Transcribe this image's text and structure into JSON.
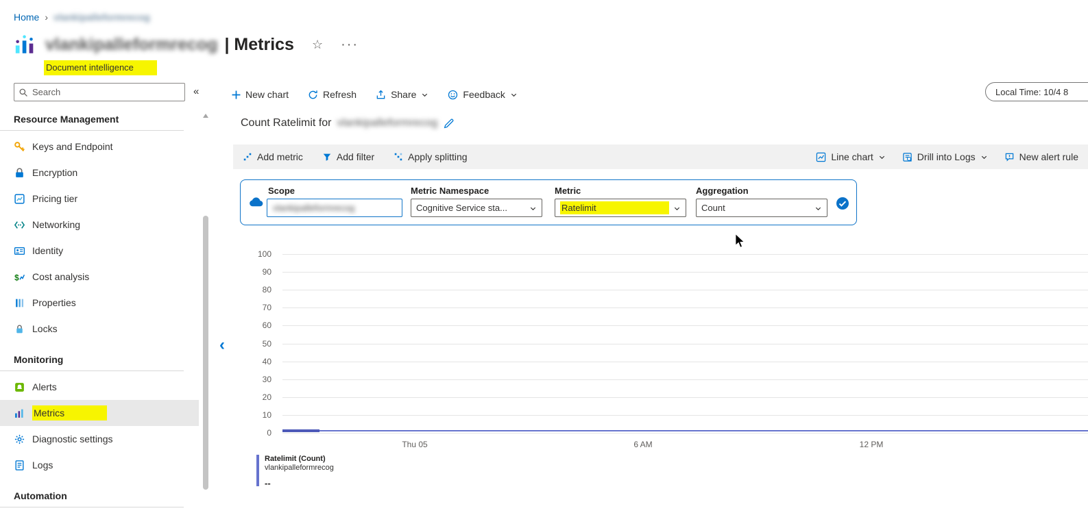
{
  "colors": {
    "accent": "#0078d4",
    "highlight": "#f7f500",
    "chart_line": "#6673ce"
  },
  "breadcrumb": {
    "home": "Home",
    "separator": "›",
    "resource": "vlankipalleformrecog"
  },
  "header": {
    "resource_name": "vlankipalleformrecog",
    "page_title": "| Metrics",
    "subtitle": "Document intelligence",
    "star_glyph": "☆",
    "more_glyph": "···"
  },
  "sidebar": {
    "search": {
      "placeholder": "Search"
    },
    "collapse_glyph": "«",
    "sections": [
      {
        "title": "Resource Management",
        "items": [
          {
            "label": "Keys and Endpoint"
          },
          {
            "label": "Encryption"
          },
          {
            "label": "Pricing tier"
          },
          {
            "label": "Networking"
          },
          {
            "label": "Identity"
          },
          {
            "label": "Cost analysis"
          },
          {
            "label": "Properties"
          },
          {
            "label": "Locks"
          }
        ]
      },
      {
        "title": "Monitoring",
        "items": [
          {
            "label": "Alerts"
          },
          {
            "label": "Metrics",
            "selected": true,
            "highlighted": true
          },
          {
            "label": "Diagnostic settings"
          },
          {
            "label": "Logs"
          }
        ]
      },
      {
        "title": "Automation",
        "items": []
      }
    ]
  },
  "toolbar": {
    "new_chart": "New chart",
    "refresh": "Refresh",
    "share": "Share",
    "feedback": "Feedback",
    "local_time": "Local Time: 10/4 8"
  },
  "chart_header": {
    "title_prefix": "Count Ratelimit for",
    "resource_name": "vlankipalleformrecog"
  },
  "chart_toolbar": {
    "add_metric": "Add metric",
    "add_filter": "Add filter",
    "apply_splitting": "Apply splitting",
    "line_chart": "Line chart",
    "drill_into_logs": "Drill into Logs",
    "new_alert_rule": "New alert rule"
  },
  "metric_picker": {
    "scope_label": "Scope",
    "scope_value": "vlankipalleformrecog",
    "namespace_label": "Metric Namespace",
    "namespace_value": "Cognitive Service sta...",
    "metric_label": "Metric",
    "metric_value": "Ratelimit",
    "aggregation_label": "Aggregation",
    "aggregation_value": "Count"
  },
  "chart_data": {
    "type": "line",
    "title": "Count Ratelimit for vlankipalleformrecog",
    "ylim": [
      0,
      100
    ],
    "y_ticks": [
      100,
      90,
      80,
      70,
      60,
      50,
      40,
      30,
      20,
      10,
      0
    ],
    "x_ticks": [
      "Thu 05",
      "6 AM",
      "12 PM"
    ],
    "grid": true,
    "legend_position": "bottom-left",
    "series": [
      {
        "name": "Ratelimit (Count)",
        "resource": "vlankipalleformrecog",
        "aggregation": "Count",
        "values": [
          0,
          0,
          0,
          0,
          0,
          0,
          0,
          0,
          0
        ],
        "current_value": "--"
      }
    ]
  },
  "legend": {
    "metric": "Ratelimit (Count)",
    "resource": "vlankipalleformrecog",
    "value": "--"
  }
}
